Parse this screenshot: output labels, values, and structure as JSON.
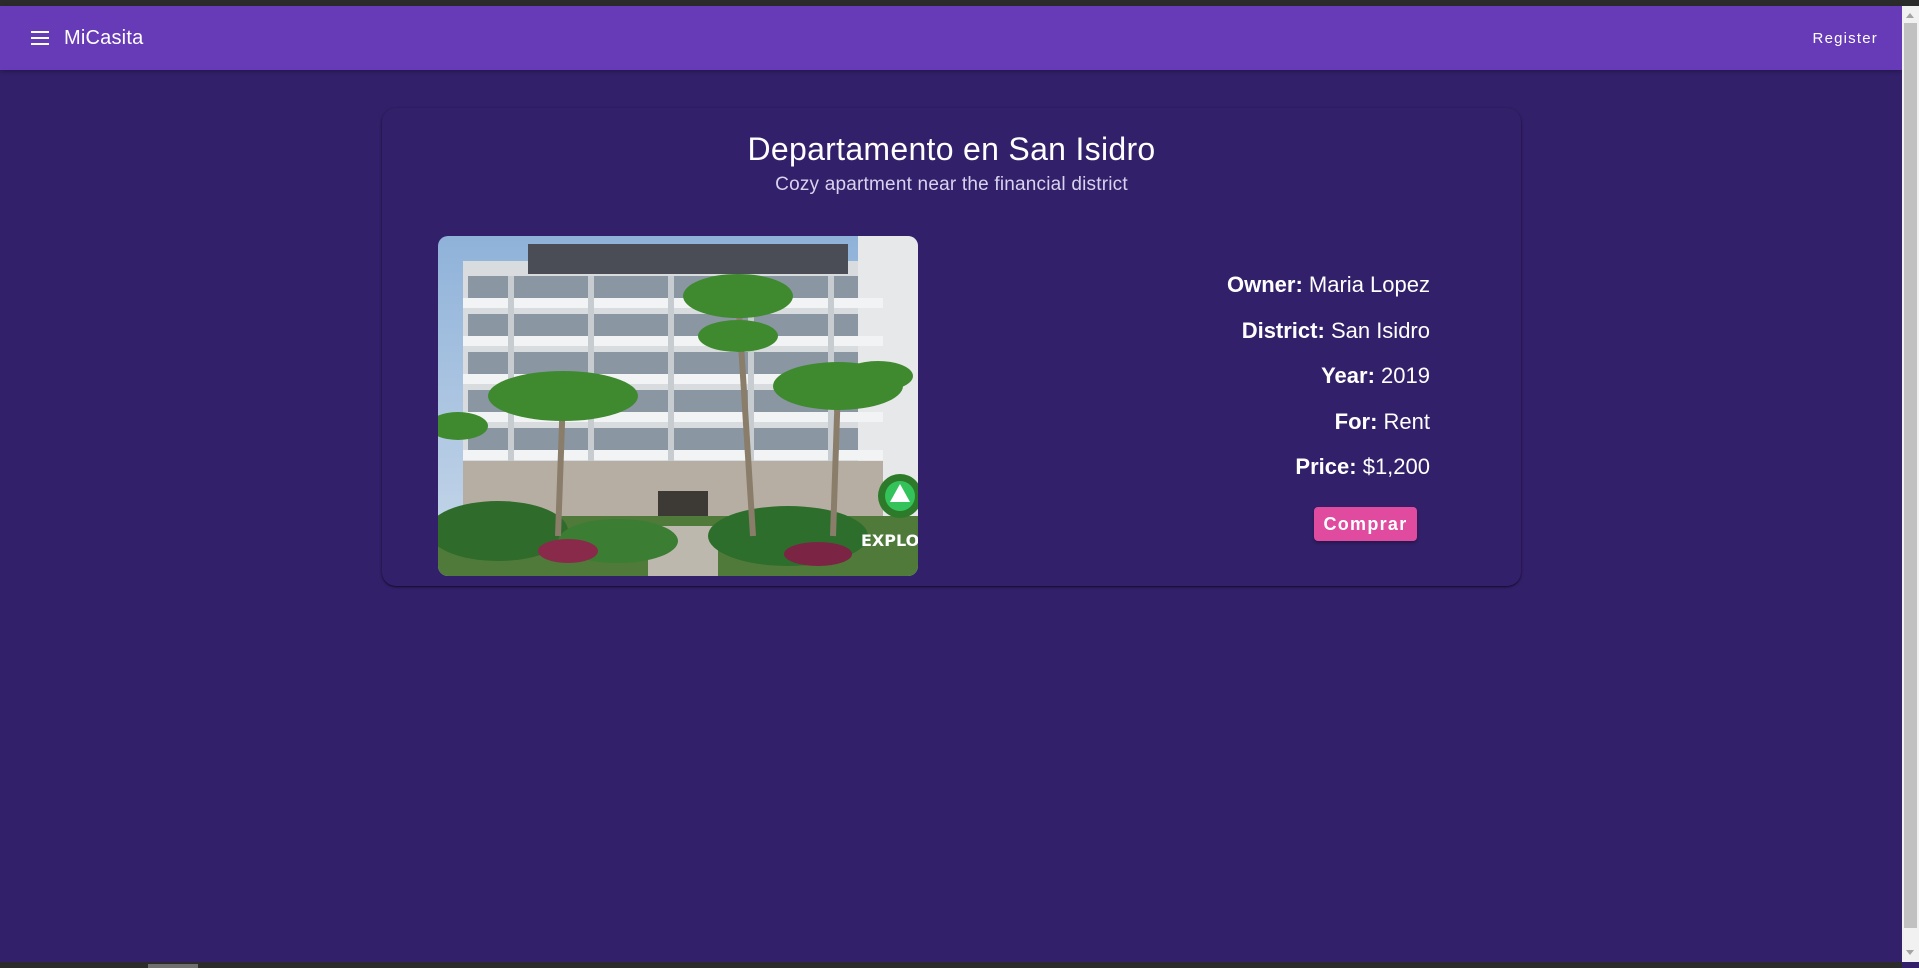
{
  "toolbar": {
    "brand": "MiCasita",
    "menu_icon": "menu-icon",
    "register_label": "Register",
    "color": "#673ab7"
  },
  "property": {
    "title": "Departamento en San Isidro",
    "subtitle": "Cozy apartment near the financial district",
    "photo_overlay_text": "EXPLOR",
    "details": [
      {
        "label": "Owner:",
        "value": "Maria Lopez"
      },
      {
        "label": "District:",
        "value": "San Isidro"
      },
      {
        "label": "Year:",
        "value": "2019"
      },
      {
        "label": "For:",
        "value": "Rent"
      },
      {
        "label": "Price:",
        "value": "$1,200"
      }
    ],
    "buy_label": "Comprar"
  },
  "colors": {
    "background": "#33206b",
    "accent_button": "#e04a9f"
  }
}
